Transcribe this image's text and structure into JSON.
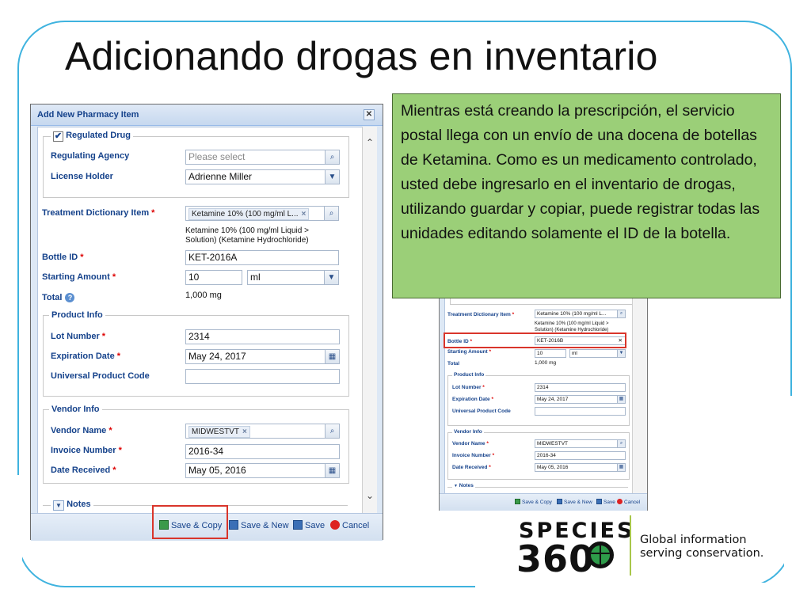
{
  "slide": {
    "title": "Adicionando drogas en inventario",
    "note": "Mientras está creando la prescripción, el servicio postal llega con un envío de una docena de botellas de Ketamina. Como es un medicamento controlado, usted debe ingresarlo en el inventario de drogas, utilizando guardar y copiar, puede registrar todas las unidades editando solamente el ID de la botella.",
    "accent_color": "#3fb3df",
    "note_color": "#9bcf78",
    "highlight_color": "#d9352b"
  },
  "dialog": {
    "title": "Add New Pharmacy Item",
    "close_icon": "close-icon",
    "regulated_drug": {
      "legend": "Regulated Drug",
      "checked": true,
      "regulating_agency_label": "Regulating Agency",
      "regulating_agency_placeholder": "Please select",
      "license_holder_label": "License Holder",
      "license_holder_value": "Adrienne Miller"
    },
    "treatment_label": "Treatment Dictionary Item",
    "treatment_tag": "Ketamine 10% (100 mg/ml L...",
    "treatment_desc_1": "Ketamine 10% (100 mg/ml Liquid >",
    "treatment_desc_2": "Solution) (Ketamine Hydrochloride)",
    "bottle_id_label": "Bottle ID",
    "bottle_id_value": "KET-2016A",
    "starting_amount_label": "Starting Amount",
    "starting_amount_value": "10",
    "starting_amount_unit": "ml",
    "total_label": "Total",
    "total_value": "1,000 mg",
    "product_info": {
      "legend": "Product Info",
      "lot_number_label": "Lot Number",
      "lot_number_value": "2314",
      "expiration_label": "Expiration Date",
      "expiration_value": "May 24, 2017",
      "upc_label": "Universal Product Code",
      "upc_value": ""
    },
    "vendor_info": {
      "legend": "Vendor Info",
      "vendor_name_label": "Vendor Name",
      "vendor_name_tag": "MIDWESTVT",
      "invoice_label": "Invoice Number",
      "invoice_value": "2016-34",
      "date_received_label": "Date Received",
      "date_received_value": "May 05, 2016"
    },
    "notes_legend": "Notes",
    "buttons": {
      "save_copy": "Save & Copy",
      "save_new": "Save & New",
      "save": "Save",
      "cancel": "Cancel"
    }
  },
  "small_dialog": {
    "treatment_label": "Treatment Dictionary Item",
    "treatment_tag": "Ketamine 10% (100 mg/ml L...",
    "treatment_desc_1": "Ketamine 10% (100 mg/ml Liquid >",
    "treatment_desc_2": "Solution) (Ketamine Hydrochloride)",
    "bottle_id_label": "Bottle ID",
    "bottle_id_value": "KET-2016B",
    "starting_amount_label": "Starting Amount",
    "starting_amount_value": "10",
    "starting_amount_unit": "ml",
    "total_label": "Total",
    "total_value": "1,000 mg",
    "product_info_legend": "Product Info",
    "lot_number_label": "Lot Number",
    "lot_number_value": "2314",
    "expiration_label": "Expiration Date",
    "expiration_value": "May 24, 2017",
    "upc_label": "Universal Product Code",
    "vendor_info_legend": "Vendor Info",
    "vendor_name_label": "Vendor Name",
    "vendor_name_tag": "MIDWESTVT",
    "invoice_label": "Invoice Number",
    "invoice_value": "2016-34",
    "date_received_label": "Date Received",
    "date_received_value": "May 05, 2016",
    "notes_legend": "Notes",
    "buttons": {
      "save_copy": "Save & Copy",
      "save_new": "Save & New",
      "save": "Save",
      "cancel": "Cancel"
    }
  },
  "logo": {
    "word": "SPECIES",
    "number": "360",
    "tagline_1": "Global information",
    "tagline_2": "serving conservation."
  }
}
